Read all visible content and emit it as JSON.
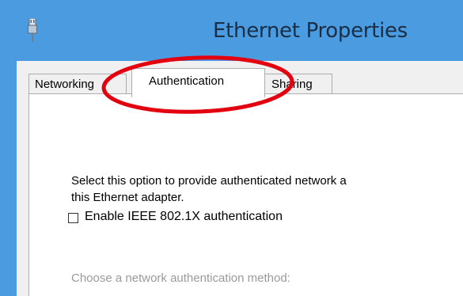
{
  "window": {
    "title": "Ethernet Properties",
    "icon": "network-adapter-icon"
  },
  "tabs": [
    {
      "label": "Networking",
      "active": false
    },
    {
      "label": "Authentication",
      "active": true
    },
    {
      "label": "Sharing",
      "active": false
    }
  ],
  "panel": {
    "description_line1": "Select this option to provide authenticated network a",
    "description_line2": "this Ethernet adapter.",
    "enable_checkbox": {
      "label": "Enable IEEE 802.1X authentication",
      "checked": false
    },
    "method_label": "Choose a network authentication method:"
  },
  "annotation": {
    "shape": "ellipse",
    "target": "Authentication tab",
    "color": "#e3000f"
  },
  "colors": {
    "title_bar": "#4b9be0",
    "title_text": "#1b2e44",
    "dialog_bg": "#f0f0f0",
    "disabled_text": "#9a9a9a"
  }
}
